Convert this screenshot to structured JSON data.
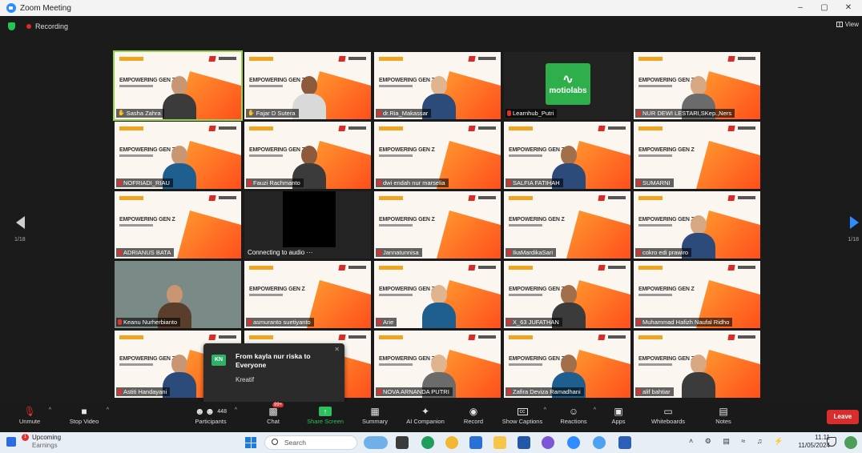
{
  "window": {
    "title": "Zoom Meeting",
    "min": "–",
    "max": "▢",
    "close": "✕"
  },
  "meeting": {
    "recording_label": "Recording",
    "view_label": "View",
    "page_left": "1/18",
    "page_right": "1/18"
  },
  "tiles": [
    {
      "name": "Sasha Zahra",
      "kind": "slide-person",
      "active": true,
      "hand": true
    },
    {
      "name": "Fajar D Sutera",
      "kind": "slide-person",
      "hand": true
    },
    {
      "name": "dr.Ria_Makassar",
      "kind": "slide-person"
    },
    {
      "name": "Learnhub_Putri",
      "kind": "motio",
      "brand": "motiolabs"
    },
    {
      "name": "NUR DEWI LESTARI,SKep.,Ners",
      "kind": "slide-person"
    },
    {
      "name": "NOFRIADI_RIAU",
      "kind": "slide-person"
    },
    {
      "name": "Fauzi Rachmanto",
      "kind": "slide-person"
    },
    {
      "name": "dwi endah nur marselia",
      "kind": "slide"
    },
    {
      "name": "SALFIA FATIHAH",
      "kind": "slide-person"
    },
    {
      "name": "SUMARNI",
      "kind": "slide"
    },
    {
      "name": "ADRIANUS BATA",
      "kind": "slide"
    },
    {
      "name": "Connecting to audio ···",
      "kind": "dark"
    },
    {
      "name": "Jannatunnisa",
      "kind": "slide"
    },
    {
      "name": "IkaMardikaSari",
      "kind": "slide"
    },
    {
      "name": "cokro edi prawiro",
      "kind": "slide-person"
    },
    {
      "name": "Keanu Nurherbianto",
      "kind": "person"
    },
    {
      "name": "asmuranto suetiyanto",
      "kind": "slide"
    },
    {
      "name": "Arie",
      "kind": "slide-person"
    },
    {
      "name": "X_63 JUFATHAN",
      "kind": "slide-person"
    },
    {
      "name": "Muhammad Hafizh Naufal Ridho",
      "kind": "slide"
    },
    {
      "name": "Astiti Handayani",
      "kind": "slide-person"
    },
    {
      "name": "",
      "kind": "slide"
    },
    {
      "name": "NOVA ARNANDA PUTRI",
      "kind": "slide-person"
    },
    {
      "name": "Zafira Deviza Ramadhani",
      "kind": "slide-person"
    },
    {
      "name": "alif bahtiar",
      "kind": "slide-person"
    }
  ],
  "slide": {
    "title": "EMPOWERING GEN Z"
  },
  "chat_popup": {
    "avatar": "KN",
    "from": "From kayla nur riska to Everyone",
    "message": "Kreatif",
    "close": "✕"
  },
  "toolbar": {
    "unmute": "Unmute",
    "stop_video": "Stop Video",
    "participants": "Participants",
    "participants_count": "448",
    "chat": "Chat",
    "chat_badge": "99+",
    "share_screen": "Share Screen",
    "summary": "Summary",
    "ai_companion": "AI Companion",
    "record": "Record",
    "show_captions": "Show Captions",
    "reactions": "Reactions",
    "apps": "Apps",
    "whiteboards": "Whiteboards",
    "notes": "Notes",
    "leave": "Leave"
  },
  "taskbar": {
    "upcoming": "Upcoming",
    "upcoming_sub": "Earnings",
    "upcoming_badge": "1",
    "search": "Search",
    "time": "11.11",
    "date": "11/05/2024"
  },
  "colors": {
    "accent": "#2d8cff",
    "leave": "#d92c2c",
    "share": "#2fbf5f",
    "active_speaker": "#9ad14b"
  }
}
